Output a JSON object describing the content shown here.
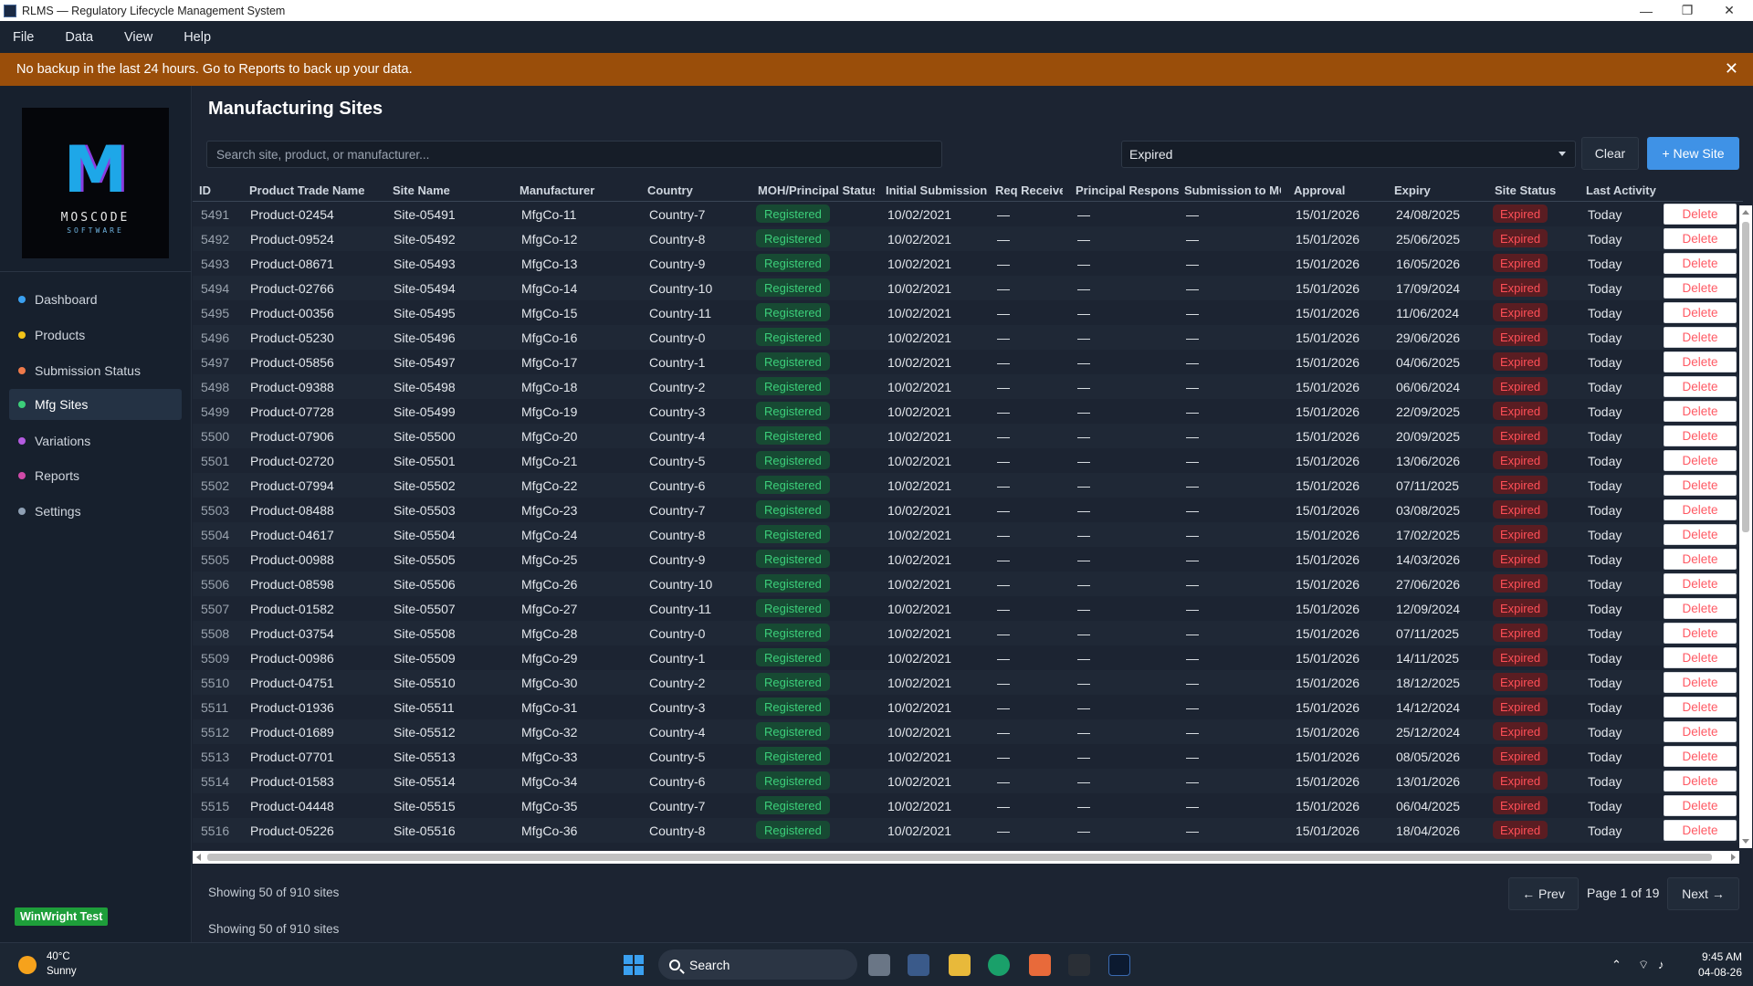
{
  "window": {
    "title": "RLMS — Regulatory Lifecycle Management System",
    "minimize": "—",
    "maximize": "❐",
    "close": "✕"
  },
  "menu": [
    "File",
    "Data",
    "View",
    "Help"
  ],
  "banner": {
    "text": "No backup in the last 24 hours. Go to Reports to back up your data.",
    "close": "✕"
  },
  "logo": {
    "name": "MOSCODE",
    "tagline": "SOFTWARE"
  },
  "sidebar": {
    "items": [
      {
        "label": "Dashboard",
        "color": "#3aa0f0"
      },
      {
        "label": "Products",
        "color": "#f2c318"
      },
      {
        "label": "Submission Status",
        "color": "#ef7a4a"
      },
      {
        "label": "Mfg Sites",
        "color": "#3ccf7a",
        "active": true
      },
      {
        "label": "Variations",
        "color": "#b45be0"
      },
      {
        "label": "Reports",
        "color": "#d04aa8"
      },
      {
        "label": "Settings",
        "color": "#8fa0b4"
      }
    ],
    "badge": "WinWright Test"
  },
  "page": {
    "title": "Manufacturing Sites",
    "search_placeholder": "Search site, product, or manufacturer...",
    "filter_value": "Expired",
    "clear_label": "Clear",
    "new_label": "+ New Site"
  },
  "table": {
    "columns": [
      "ID",
      "Product Trade Name",
      "Site Name",
      "Manufacturer",
      "Country",
      "MOH/Principal Status",
      "Initial Submission",
      "Req Received",
      "Principal Response",
      "Submission to MOH",
      "Approval",
      "Expiry",
      "Site Status",
      "Last Activity"
    ],
    "dash": "—",
    "delete_label": "Delete",
    "rows": [
      {
        "id": "5491",
        "product": "Product-02454",
        "site": "Site-05491",
        "mfr": "MfgCo-11",
        "country": "Country-7",
        "moh": "Registered",
        "initial": "10/02/2021",
        "approval": "15/01/2026",
        "expiry": "24/08/2025",
        "status": "Expired",
        "last": "Today"
      },
      {
        "id": "5492",
        "product": "Product-09524",
        "site": "Site-05492",
        "mfr": "MfgCo-12",
        "country": "Country-8",
        "moh": "Registered",
        "initial": "10/02/2021",
        "approval": "15/01/2026",
        "expiry": "25/06/2025",
        "status": "Expired",
        "last": "Today"
      },
      {
        "id": "5493",
        "product": "Product-08671",
        "site": "Site-05493",
        "mfr": "MfgCo-13",
        "country": "Country-9",
        "moh": "Registered",
        "initial": "10/02/2021",
        "approval": "15/01/2026",
        "expiry": "16/05/2026",
        "status": "Expired",
        "last": "Today"
      },
      {
        "id": "5494",
        "product": "Product-02766",
        "site": "Site-05494",
        "mfr": "MfgCo-14",
        "country": "Country-10",
        "moh": "Registered",
        "initial": "10/02/2021",
        "approval": "15/01/2026",
        "expiry": "17/09/2024",
        "status": "Expired",
        "last": "Today"
      },
      {
        "id": "5495",
        "product": "Product-00356",
        "site": "Site-05495",
        "mfr": "MfgCo-15",
        "country": "Country-11",
        "moh": "Registered",
        "initial": "10/02/2021",
        "approval": "15/01/2026",
        "expiry": "11/06/2024",
        "status": "Expired",
        "last": "Today"
      },
      {
        "id": "5496",
        "product": "Product-05230",
        "site": "Site-05496",
        "mfr": "MfgCo-16",
        "country": "Country-0",
        "moh": "Registered",
        "initial": "10/02/2021",
        "approval": "15/01/2026",
        "expiry": "29/06/2026",
        "status": "Expired",
        "last": "Today"
      },
      {
        "id": "5497",
        "product": "Product-05856",
        "site": "Site-05497",
        "mfr": "MfgCo-17",
        "country": "Country-1",
        "moh": "Registered",
        "initial": "10/02/2021",
        "approval": "15/01/2026",
        "expiry": "04/06/2025",
        "status": "Expired",
        "last": "Today"
      },
      {
        "id": "5498",
        "product": "Product-09388",
        "site": "Site-05498",
        "mfr": "MfgCo-18",
        "country": "Country-2",
        "moh": "Registered",
        "initial": "10/02/2021",
        "approval": "15/01/2026",
        "expiry": "06/06/2024",
        "status": "Expired",
        "last": "Today"
      },
      {
        "id": "5499",
        "product": "Product-07728",
        "site": "Site-05499",
        "mfr": "MfgCo-19",
        "country": "Country-3",
        "moh": "Registered",
        "initial": "10/02/2021",
        "approval": "15/01/2026",
        "expiry": "22/09/2025",
        "status": "Expired",
        "last": "Today"
      },
      {
        "id": "5500",
        "product": "Product-07906",
        "site": "Site-05500",
        "mfr": "MfgCo-20",
        "country": "Country-4",
        "moh": "Registered",
        "initial": "10/02/2021",
        "approval": "15/01/2026",
        "expiry": "20/09/2025",
        "status": "Expired",
        "last": "Today"
      },
      {
        "id": "5501",
        "product": "Product-02720",
        "site": "Site-05501",
        "mfr": "MfgCo-21",
        "country": "Country-5",
        "moh": "Registered",
        "initial": "10/02/2021",
        "approval": "15/01/2026",
        "expiry": "13/06/2026",
        "status": "Expired",
        "last": "Today"
      },
      {
        "id": "5502",
        "product": "Product-07994",
        "site": "Site-05502",
        "mfr": "MfgCo-22",
        "country": "Country-6",
        "moh": "Registered",
        "initial": "10/02/2021",
        "approval": "15/01/2026",
        "expiry": "07/11/2025",
        "status": "Expired",
        "last": "Today"
      },
      {
        "id": "5503",
        "product": "Product-08488",
        "site": "Site-05503",
        "mfr": "MfgCo-23",
        "country": "Country-7",
        "moh": "Registered",
        "initial": "10/02/2021",
        "approval": "15/01/2026",
        "expiry": "03/08/2025",
        "status": "Expired",
        "last": "Today"
      },
      {
        "id": "5504",
        "product": "Product-04617",
        "site": "Site-05504",
        "mfr": "MfgCo-24",
        "country": "Country-8",
        "moh": "Registered",
        "initial": "10/02/2021",
        "approval": "15/01/2026",
        "expiry": "17/02/2025",
        "status": "Expired",
        "last": "Today"
      },
      {
        "id": "5505",
        "product": "Product-00988",
        "site": "Site-05505",
        "mfr": "MfgCo-25",
        "country": "Country-9",
        "moh": "Registered",
        "initial": "10/02/2021",
        "approval": "15/01/2026",
        "expiry": "14/03/2026",
        "status": "Expired",
        "last": "Today"
      },
      {
        "id": "5506",
        "product": "Product-08598",
        "site": "Site-05506",
        "mfr": "MfgCo-26",
        "country": "Country-10",
        "moh": "Registered",
        "initial": "10/02/2021",
        "approval": "15/01/2026",
        "expiry": "27/06/2026",
        "status": "Expired",
        "last": "Today"
      },
      {
        "id": "5507",
        "product": "Product-01582",
        "site": "Site-05507",
        "mfr": "MfgCo-27",
        "country": "Country-11",
        "moh": "Registered",
        "initial": "10/02/2021",
        "approval": "15/01/2026",
        "expiry": "12/09/2024",
        "status": "Expired",
        "last": "Today"
      },
      {
        "id": "5508",
        "product": "Product-03754",
        "site": "Site-05508",
        "mfr": "MfgCo-28",
        "country": "Country-0",
        "moh": "Registered",
        "initial": "10/02/2021",
        "approval": "15/01/2026",
        "expiry": "07/11/2025",
        "status": "Expired",
        "last": "Today"
      },
      {
        "id": "5509",
        "product": "Product-00986",
        "site": "Site-05509",
        "mfr": "MfgCo-29",
        "country": "Country-1",
        "moh": "Registered",
        "initial": "10/02/2021",
        "approval": "15/01/2026",
        "expiry": "14/11/2025",
        "status": "Expired",
        "last": "Today"
      },
      {
        "id": "5510",
        "product": "Product-04751",
        "site": "Site-05510",
        "mfr": "MfgCo-30",
        "country": "Country-2",
        "moh": "Registered",
        "initial": "10/02/2021",
        "approval": "15/01/2026",
        "expiry": "18/12/2025",
        "status": "Expired",
        "last": "Today"
      },
      {
        "id": "5511",
        "product": "Product-01936",
        "site": "Site-05511",
        "mfr": "MfgCo-31",
        "country": "Country-3",
        "moh": "Registered",
        "initial": "10/02/2021",
        "approval": "15/01/2026",
        "expiry": "14/12/2024",
        "status": "Expired",
        "last": "Today"
      },
      {
        "id": "5512",
        "product": "Product-01689",
        "site": "Site-05512",
        "mfr": "MfgCo-32",
        "country": "Country-4",
        "moh": "Registered",
        "initial": "10/02/2021",
        "approval": "15/01/2026",
        "expiry": "25/12/2024",
        "status": "Expired",
        "last": "Today"
      },
      {
        "id": "5513",
        "product": "Product-07701",
        "site": "Site-05513",
        "mfr": "MfgCo-33",
        "country": "Country-5",
        "moh": "Registered",
        "initial": "10/02/2021",
        "approval": "15/01/2026",
        "expiry": "08/05/2026",
        "status": "Expired",
        "last": "Today"
      },
      {
        "id": "5514",
        "product": "Product-01583",
        "site": "Site-05514",
        "mfr": "MfgCo-34",
        "country": "Country-6",
        "moh": "Registered",
        "initial": "10/02/2021",
        "approval": "15/01/2026",
        "expiry": "13/01/2026",
        "status": "Expired",
        "last": "Today"
      },
      {
        "id": "5515",
        "product": "Product-04448",
        "site": "Site-05515",
        "mfr": "MfgCo-35",
        "country": "Country-7",
        "moh": "Registered",
        "initial": "10/02/2021",
        "approval": "15/01/2026",
        "expiry": "06/04/2025",
        "status": "Expired",
        "last": "Today"
      },
      {
        "id": "5516",
        "product": "Product-05226",
        "site": "Site-05516",
        "mfr": "MfgCo-36",
        "country": "Country-8",
        "moh": "Registered",
        "initial": "10/02/2021",
        "approval": "15/01/2026",
        "expiry": "18/04/2026",
        "status": "Expired",
        "last": "Today"
      }
    ]
  },
  "footer": {
    "count_text": "Showing 50 of 910 sites",
    "count_text_2": "Showing 50 of 910 sites",
    "prev_label": "← Prev",
    "page_label": "Page 1 of 19",
    "next_label": "Next →"
  },
  "taskbar": {
    "temperature": "40°C",
    "condition": "Sunny",
    "search_label": "Search",
    "time": "9:45 AM",
    "date": "04-08-26"
  }
}
